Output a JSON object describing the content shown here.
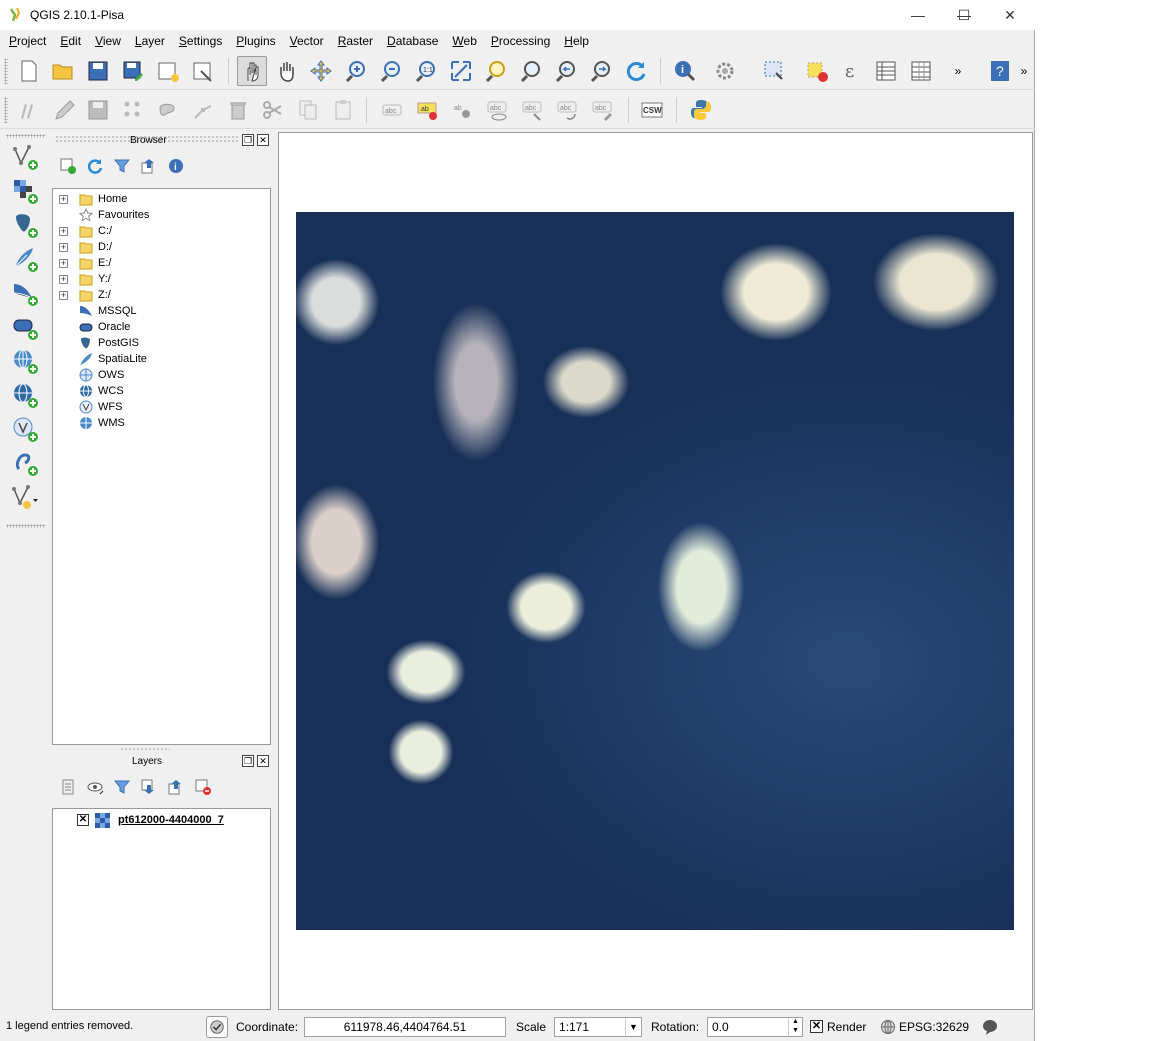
{
  "window": {
    "title": "QGIS 2.10.1-Pisa",
    "minimize_glyph": "—",
    "maximize_glyph": "☐",
    "close_glyph": "✕"
  },
  "menu": [
    {
      "underline": "P",
      "rest": "roject"
    },
    {
      "underline": "E",
      "rest": "dit"
    },
    {
      "underline": "V",
      "rest": "iew"
    },
    {
      "underline": "L",
      "rest": "ayer"
    },
    {
      "underline": "S",
      "rest": "ettings"
    },
    {
      "underline": "P",
      "rest": "lugins"
    },
    {
      "underline": "V",
      "rest": "ector"
    },
    {
      "underline": "R",
      "rest": "aster"
    },
    {
      "underline": "D",
      "rest": "atabase"
    },
    {
      "underline": "W",
      "rest": "eb"
    },
    {
      "underline": "P",
      "rest": "rocessing"
    },
    {
      "underline": "H",
      "rest": "elp"
    }
  ],
  "toolbar": {
    "overflow_glyph": "»",
    "csw_label": "CSW",
    "abc_label": "abc",
    "ab_label": "ab"
  },
  "browser": {
    "title": "Browser",
    "items": [
      {
        "label": "Home",
        "expandable": true,
        "icon": "folder-icon"
      },
      {
        "label": "Favourites",
        "expandable": false,
        "icon": "star-icon"
      },
      {
        "label": "C:/",
        "expandable": true,
        "icon": "folder-icon"
      },
      {
        "label": "D:/",
        "expandable": true,
        "icon": "folder-icon"
      },
      {
        "label": "E:/",
        "expandable": true,
        "icon": "folder-icon"
      },
      {
        "label": "Y:/",
        "expandable": true,
        "icon": "folder-icon"
      },
      {
        "label": "Z:/",
        "expandable": true,
        "icon": "folder-icon"
      },
      {
        "label": "MSSQL",
        "expandable": false,
        "icon": "mssql-icon"
      },
      {
        "label": "Oracle",
        "expandable": false,
        "icon": "oracle-icon"
      },
      {
        "label": "PostGIS",
        "expandable": false,
        "icon": "postgis-icon"
      },
      {
        "label": "SpatiaLite",
        "expandable": false,
        "icon": "spatialite-icon"
      },
      {
        "label": "OWS",
        "expandable": false,
        "icon": "ows-icon"
      },
      {
        "label": "WCS",
        "expandable": false,
        "icon": "wcs-icon"
      },
      {
        "label": "WFS",
        "expandable": false,
        "icon": "wfs-icon"
      },
      {
        "label": "WMS",
        "expandable": false,
        "icon": "wms-icon"
      }
    ]
  },
  "layers": {
    "title": "Layers",
    "items": [
      {
        "name": "pt612000-4404000_7",
        "visible": true
      }
    ]
  },
  "status": {
    "message": "1 legend entries removed.",
    "coordinate_label": "Coordinate:",
    "coordinate_value": "611978.46,4404764.51",
    "scale_label": "Scale",
    "scale_value": "1:171",
    "rotation_label": "Rotation:",
    "rotation_value": "0.0",
    "render_label": "Render",
    "render_checked": true,
    "crs": "EPSG:32629"
  },
  "colors": {
    "accent": "#3b7dd8",
    "folder": "#f5d36b",
    "raster_water": "#1f3a66"
  }
}
